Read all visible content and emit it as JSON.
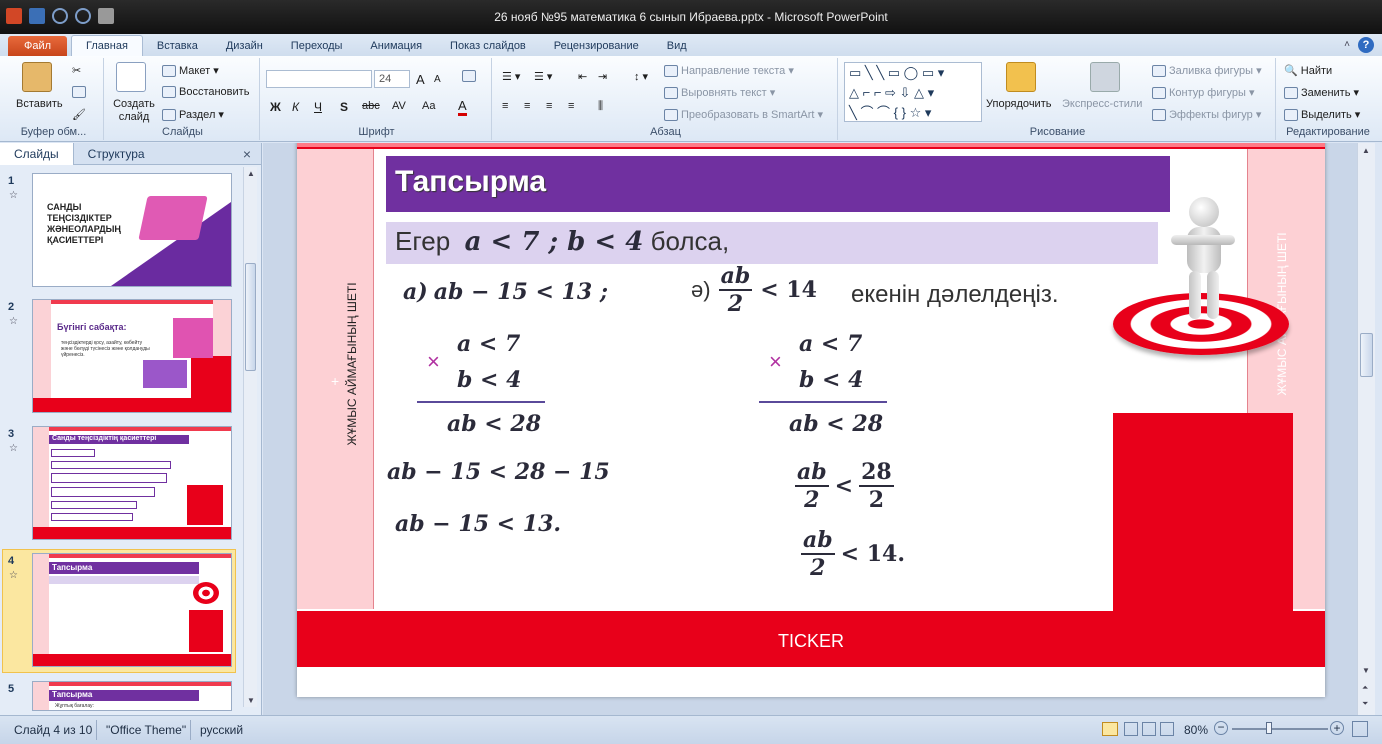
{
  "window": {
    "title": "26 нояб №95 математика 6 сынып Ибраева.pptx  -  Microsoft PowerPoint",
    "help_label": "?"
  },
  "tabs": [
    "Файл",
    "Главная",
    "Вставка",
    "Дизайн",
    "Переходы",
    "Анимация",
    "Показ слайдов",
    "Рецензирование",
    "Вид"
  ],
  "ribbon": {
    "clipboard": {
      "paste": "Вставить",
      "label": "Буфер обм..."
    },
    "slides": {
      "new_slide": "Создать слайд",
      "layout": "Макет",
      "reset": "Восстановить",
      "section": "Раздел",
      "label": "Слайды"
    },
    "font": {
      "size": "24",
      "bold": "Ж",
      "italic": "К",
      "underline": "Ч",
      "shadow": "S",
      "strike": "abc",
      "spacing": "AV",
      "case": "Aa",
      "grow": "A",
      "shrink": "A",
      "color": "A",
      "label": "Шрифт"
    },
    "paragraph": {
      "text_direction": "Направление текста",
      "align_text": "Выровнять текст",
      "smartart": "Преобразовать в SmartArt",
      "label": "Абзац"
    },
    "drawing": {
      "arrange": "Упорядочить",
      "quick_styles": "Экспресс-стили",
      "fill": "Заливка фигуры",
      "outline": "Контур фигуры",
      "effects": "Эффекты фигур",
      "label": "Рисование"
    },
    "editing": {
      "find": "Найти",
      "replace": "Заменить",
      "select": "Выделить",
      "label": "Редактирование"
    }
  },
  "left_pane": {
    "tabs": [
      "Слайды",
      "Структура"
    ],
    "close": "×",
    "thumbnails": [
      {
        "num": "1",
        "title": "САНДЫ ТЕҢСІЗДІКТЕР ЖӘНЕОЛАРДЫҢ ҚАСИЕТТЕРІ"
      },
      {
        "num": "2",
        "title": "Бүгінгі сабақта:",
        "text": "теңсіздіктерді қосу, азайту, көбейту және бөлуді түсінесіз және қолдануды үйренесіз."
      },
      {
        "num": "3",
        "title": "Санды теңсіздіктің қасиеттері"
      },
      {
        "num": "4",
        "title": "Тапсырма"
      },
      {
        "num": "5",
        "title": "Тапсырма",
        "text": "Жұптық бағалау:"
      }
    ]
  },
  "slide": {
    "title": "Тапсырма",
    "condition_word": "Егер",
    "condition_math": "a < 7 ;  b < 4",
    "condition_tail": "болса,",
    "task_a_label": "а)",
    "task_a": "ab − 15 < 13 ;",
    "task_b_label": "ә)",
    "task_b_num": "ab",
    "task_b_den": "2",
    "task_b_rest": "< 14",
    "prove_text": "екенін дәлелдеңіз.",
    "left_work": {
      "line1": "a < 7",
      "line2": "b < 4",
      "times": "×",
      "result": "ab < 28",
      "step2": "ab − 15 < 28 − 15",
      "step3": "ab − 15 < 13."
    },
    "right_work": {
      "line1": "a < 7",
      "line2": "b < 4",
      "times": "×",
      "result": "ab < 28",
      "frac1_num": "ab",
      "frac1_den": "2",
      "lt": "<",
      "frac2_num": "28",
      "frac2_den": "2",
      "final_num": "ab",
      "final_den": "2",
      "final_rest": "< 14."
    },
    "side_left": "ЖҰМЫС АЙМАҒЫНЫҢ ШЕТІ",
    "side_right": "ЖҰМЫС АЙМАҒЫНЫҢ ШЕТІ",
    "plus": "+",
    "ticker": "TICKER"
  },
  "status": {
    "slide_of": "Слайд 4 из 10",
    "theme": "\"Office Theme\"",
    "language": "русский",
    "zoom": "80%"
  }
}
